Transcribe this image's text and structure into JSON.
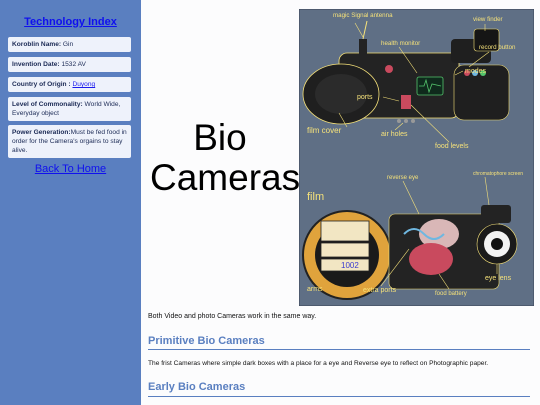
{
  "sidebar": {
    "title": "Technology Index",
    "fields": {
      "name_label": "Koroblin Name:",
      "name_value": " Gin",
      "date_label": "Invention Date:",
      "date_value": " 1532 AV",
      "origin_label": "Country of Origin :",
      "origin_value": "Duyong",
      "common_label": "Level of Commonality:",
      "common_value": " World Wide, Everyday object",
      "power_label": "Power Generation:",
      "power_value": "Must be fed food in order for the Camera's orgains to stay alive."
    },
    "back_link": "Back To Home"
  },
  "main": {
    "title": "Bio Cameras",
    "intro": "Both Video and photo Cameras work in the same way.",
    "sections": [
      {
        "heading": "Primitive Bio Cameras",
        "text": "The frist Cameras where simple dark boxes with a place for a eye and Reverse eye to reflect on Photographic paper."
      },
      {
        "heading": "Early Bio Cameras"
      }
    ]
  },
  "diagram": {
    "labels": {
      "antenna": "magic Signal antenna",
      "viewfinder": "view finder",
      "health": "health monitor",
      "record": "record button",
      "modes": "modes",
      "ports": "ports",
      "film_cover": "film cover",
      "air_holes": "air holes",
      "food_levels": "food levels",
      "reverse_eye": "reverse eye",
      "chromatophore": "chromatophore screen",
      "film": "film",
      "arms": "arms",
      "extra_ports": "extra ports",
      "food_battery": "food battery",
      "eye_lens": "eye lens"
    },
    "film_text": "1002",
    "colors": {
      "bg": "#5f6f85",
      "label": "#f6e27a",
      "body": "#232323",
      "reel": "#e0a33c",
      "organ": "#c94a5e"
    }
  }
}
